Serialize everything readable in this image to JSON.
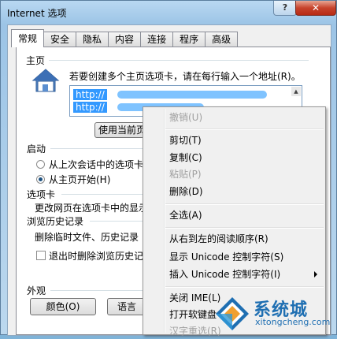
{
  "window": {
    "title": "Internet 选项",
    "help_label": "?",
    "close_label": "✕"
  },
  "tabs": [
    {
      "label": "常规",
      "active": true
    },
    {
      "label": "安全"
    },
    {
      "label": "隐私"
    },
    {
      "label": "内容"
    },
    {
      "label": "连接"
    },
    {
      "label": "程序"
    },
    {
      "label": "高级"
    }
  ],
  "home": {
    "group_label": "主页",
    "description": "若要创建多个主页选项卡，请在每行输入一个地址(R)。",
    "urls": [
      "http://",
      "http://"
    ],
    "btn_use_current": "使用当前页"
  },
  "startup": {
    "group_label": "启动",
    "option1": "从上次会话中的选项卡",
    "option2": "从主页开始(H)",
    "selected": "option2"
  },
  "tabs_group": {
    "group_label": "选项卡",
    "description": "更改网页在选项卡中的显示"
  },
  "history": {
    "group_label": "浏览历史记录",
    "description": "删除临时文件、历史记录",
    "checkbox_label": "退出时删除浏览历史记"
  },
  "appearance": {
    "group_label": "外观",
    "btn_colors": "颜色(O)",
    "btn_languages": "语言"
  },
  "context_menu": {
    "undo": "撤销(U)",
    "cut": "剪切(T)",
    "copy": "复制(C)",
    "paste": "粘贴(P)",
    "delete": "删除(D)",
    "select_all": "全选(A)",
    "rtl": "从右到左的阅读顺序(R)",
    "show_unicode": "显示 Unicode 控制字符(S)",
    "insert_unicode": "插入 Unicode 控制字符(I)",
    "close_ime": "关闭 IME(L)",
    "soft_keyboard": "打开软键盘",
    "reconvert": "汉字重选(R)"
  },
  "watermark": {
    "text": "系统城",
    "url": "xitongcheng.com"
  },
  "colors": {
    "selection": "#3399ff",
    "watermark": "#1f6fb2"
  }
}
